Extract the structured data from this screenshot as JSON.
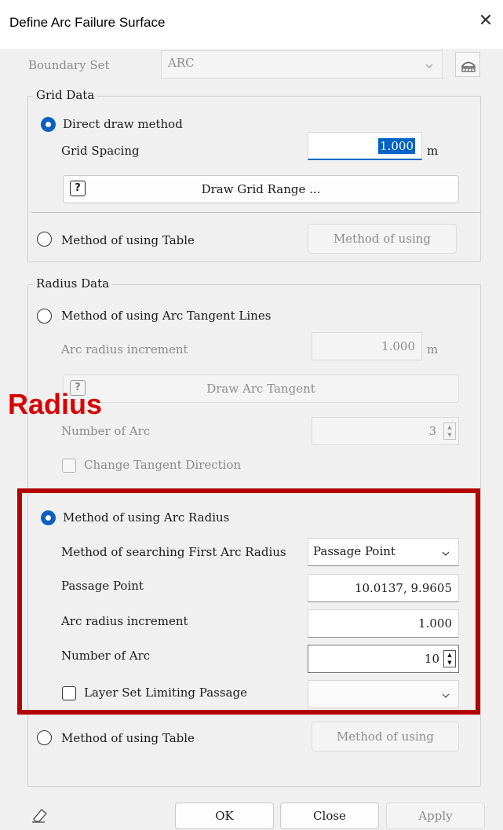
{
  "window": {
    "title": "Define Arc Failure Surface",
    "close_glyph": "✕"
  },
  "boundary": {
    "label": "Boundary Set",
    "value": "ARC",
    "icon": "boundary-set-icon"
  },
  "grid_data": {
    "title": "Grid Data",
    "direct_draw_label": "Direct draw method",
    "grid_spacing_label": "Grid Spacing",
    "grid_spacing_value": "1.000",
    "grid_spacing_unit": "m",
    "draw_grid_range_label": "Draw Grid Range ...",
    "help_glyph": "?",
    "table_method_label": "Method of using Table",
    "table_method_button": "Method of using"
  },
  "radius_data": {
    "title": "Radius Data",
    "tangent_method_label": "Method of using Arc Tangent Lines",
    "tangent_increment_label": "Arc radius increment",
    "tangent_increment_value": "1.000",
    "tangent_increment_unit": "m",
    "draw_arc_tangent_label": "Draw Arc Tangent",
    "tangent_number_label": "Number of Arc",
    "tangent_number_value": "3",
    "change_direction_label": "Change Tangent Direction",
    "arc_radius_method_label": "Method of using Arc Radius",
    "search_first_label": "Method of searching First Arc Radius",
    "search_first_value": "Passage Point",
    "passage_point_label": "Passage Point",
    "passage_point_value": "10.0137, 9.9605",
    "radius_increment_label": "Arc radius increment",
    "radius_increment_value": "1.000",
    "number_of_arc_label": "Number of Arc",
    "number_of_arc_value": "10",
    "layer_set_label": "Layer Set Limiting Passage",
    "layer_set_value": "",
    "table_method_label": "Method of using Table",
    "table_method_button": "Method of using"
  },
  "annotation": {
    "text": "Radius",
    "color": "#d80000",
    "box_color": "#b30000"
  },
  "footer": {
    "ok": "OK",
    "close": "Close",
    "apply": "Apply",
    "eraser_icon": "eraser-icon"
  },
  "colors": {
    "accent": "#0a5fbf",
    "focus_underline": "#0067c0"
  }
}
